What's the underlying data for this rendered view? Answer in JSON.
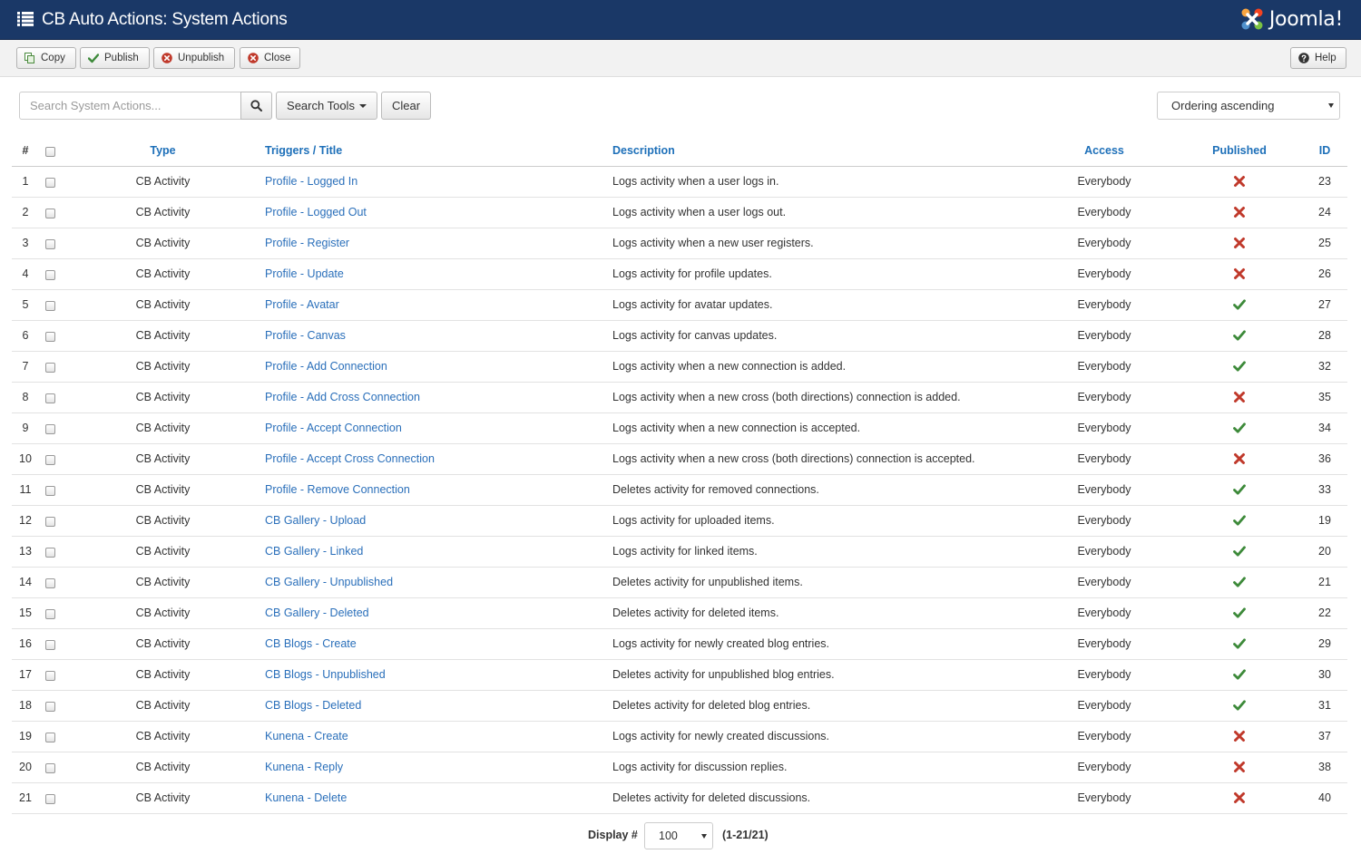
{
  "header": {
    "title": "CB Auto Actions: System Actions",
    "logo_text": "Joomla!"
  },
  "toolbar": {
    "copy_label": "Copy",
    "publish_label": "Publish",
    "unpublish_label": "Unpublish",
    "close_label": "Close",
    "help_label": "Help"
  },
  "filters": {
    "search_placeholder": "Search System Actions...",
    "search_value": "",
    "search_tools_label": "Search Tools",
    "clear_label": "Clear",
    "ordering_value": "Ordering ascending"
  },
  "table": {
    "headers": {
      "num": "#",
      "type": "Type",
      "title": "Triggers / Title",
      "description": "Description",
      "access": "Access",
      "published": "Published",
      "id": "ID"
    },
    "rows": [
      {
        "num": "1",
        "type": "CB Activity",
        "title": "Profile - Logged In",
        "description": "Logs activity when a user logs in.",
        "access": "Everybody",
        "published": false,
        "id": "23"
      },
      {
        "num": "2",
        "type": "CB Activity",
        "title": "Profile - Logged Out",
        "description": "Logs activity when a user logs out.",
        "access": "Everybody",
        "published": false,
        "id": "24"
      },
      {
        "num": "3",
        "type": "CB Activity",
        "title": "Profile - Register",
        "description": "Logs activity when a new user registers.",
        "access": "Everybody",
        "published": false,
        "id": "25"
      },
      {
        "num": "4",
        "type": "CB Activity",
        "title": "Profile - Update",
        "description": "Logs activity for profile updates.",
        "access": "Everybody",
        "published": false,
        "id": "26"
      },
      {
        "num": "5",
        "type": "CB Activity",
        "title": "Profile - Avatar",
        "description": "Logs activity for avatar updates.",
        "access": "Everybody",
        "published": true,
        "id": "27"
      },
      {
        "num": "6",
        "type": "CB Activity",
        "title": "Profile - Canvas",
        "description": "Logs activity for canvas updates.",
        "access": "Everybody",
        "published": true,
        "id": "28"
      },
      {
        "num": "7",
        "type": "CB Activity",
        "title": "Profile - Add Connection",
        "description": "Logs activity when a new connection is added.",
        "access": "Everybody",
        "published": true,
        "id": "32"
      },
      {
        "num": "8",
        "type": "CB Activity",
        "title": "Profile - Add Cross Connection",
        "description": "Logs activity when a new cross (both directions) connection is added.",
        "access": "Everybody",
        "published": false,
        "id": "35"
      },
      {
        "num": "9",
        "type": "CB Activity",
        "title": "Profile - Accept Connection",
        "description": "Logs activity when a new connection is accepted.",
        "access": "Everybody",
        "published": true,
        "id": "34"
      },
      {
        "num": "10",
        "type": "CB Activity",
        "title": "Profile - Accept Cross Connection",
        "description": "Logs activity when a new cross (both directions) connection is accepted.",
        "access": "Everybody",
        "published": false,
        "id": "36"
      },
      {
        "num": "11",
        "type": "CB Activity",
        "title": "Profile - Remove Connection",
        "description": "Deletes activity for removed connections.",
        "access": "Everybody",
        "published": true,
        "id": "33"
      },
      {
        "num": "12",
        "type": "CB Activity",
        "title": "CB Gallery - Upload",
        "description": "Logs activity for uploaded items.",
        "access": "Everybody",
        "published": true,
        "id": "19"
      },
      {
        "num": "13",
        "type": "CB Activity",
        "title": "CB Gallery - Linked",
        "description": "Logs activity for linked items.",
        "access": "Everybody",
        "published": true,
        "id": "20"
      },
      {
        "num": "14",
        "type": "CB Activity",
        "title": "CB Gallery - Unpublished",
        "description": "Deletes activity for unpublished items.",
        "access": "Everybody",
        "published": true,
        "id": "21"
      },
      {
        "num": "15",
        "type": "CB Activity",
        "title": "CB Gallery - Deleted",
        "description": "Deletes activity for deleted items.",
        "access": "Everybody",
        "published": true,
        "id": "22"
      },
      {
        "num": "16",
        "type": "CB Activity",
        "title": "CB Blogs - Create",
        "description": "Logs activity for newly created blog entries.",
        "access": "Everybody",
        "published": true,
        "id": "29"
      },
      {
        "num": "17",
        "type": "CB Activity",
        "title": "CB Blogs - Unpublished",
        "description": "Deletes activity for unpublished blog entries.",
        "access": "Everybody",
        "published": true,
        "id": "30"
      },
      {
        "num": "18",
        "type": "CB Activity",
        "title": "CB Blogs - Deleted",
        "description": "Deletes activity for deleted blog entries.",
        "access": "Everybody",
        "published": true,
        "id": "31"
      },
      {
        "num": "19",
        "type": "CB Activity",
        "title": "Kunena - Create",
        "description": "Logs activity for newly created discussions.",
        "access": "Everybody",
        "published": false,
        "id": "37"
      },
      {
        "num": "20",
        "type": "CB Activity",
        "title": "Kunena - Reply",
        "description": "Logs activity for discussion replies.",
        "access": "Everybody",
        "published": false,
        "id": "38"
      },
      {
        "num": "21",
        "type": "CB Activity",
        "title": "Kunena - Delete",
        "description": "Deletes activity for deleted discussions.",
        "access": "Everybody",
        "published": false,
        "id": "40"
      }
    ]
  },
  "footer": {
    "display_label": "Display #",
    "limit_value": "100",
    "counter": "(1-21/21)"
  },
  "colors": {
    "header_bg": "#1a3867",
    "link": "#2a6fba",
    "published_check": "#3d8a3a",
    "unpublished_x": "#c0392b"
  },
  "icons": {
    "menu": "list-icon",
    "copy": "copy-icon",
    "publish": "check-icon",
    "unpublish": "circle-x-icon",
    "close": "circle-x-icon",
    "help": "question-circle-icon",
    "search": "search-icon",
    "published": "check-icon",
    "unpublished": "x-icon"
  }
}
